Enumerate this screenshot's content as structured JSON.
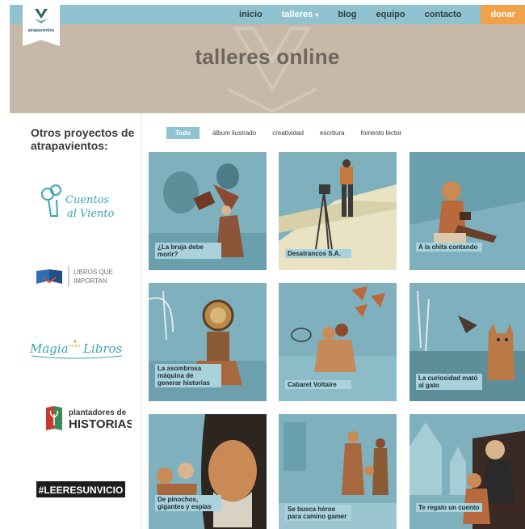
{
  "brand": {
    "name": "atrapavientos"
  },
  "nav": {
    "items": [
      {
        "label": "inicio"
      },
      {
        "label": "talleres"
      },
      {
        "label": "blog"
      },
      {
        "label": "equipo"
      },
      {
        "label": "contacto"
      }
    ],
    "cta": "donar"
  },
  "hero": {
    "title": "talleres online"
  },
  "sidebar": {
    "title": "Otros proyectos de atrapavientos:",
    "projects": [
      {
        "name": "Cuentos al Viento",
        "line1": "Cuentos",
        "line2": "al Viento"
      },
      {
        "name": "Libros que importan",
        "line1": "LIBROS QUE",
        "line2": "IMPORTAN"
      },
      {
        "name": "Magia en los Libros",
        "line1": "Magia",
        "mid": "en los",
        "line2": "Libros"
      },
      {
        "name": "plantadores de HISTORIAS",
        "line1": "plantadores de",
        "line2": "HISTORIAS"
      },
      {
        "name": "#LEERESUNVICIO",
        "line1": "#LEERESUNVICIO"
      }
    ]
  },
  "filters": [
    "Todo",
    "álbum ilustrado",
    "creatividad",
    "escritura",
    "fomento lector"
  ],
  "workshops": [
    {
      "title": "¿La bruja debe morir?"
    },
    {
      "title": "Desatrancos S.A."
    },
    {
      "title": "A la chita contando"
    },
    {
      "title": "La asombrosa máquina de generar historias"
    },
    {
      "title": "Cabaret Voltaire"
    },
    {
      "title": "La curiosidad mató al gato"
    },
    {
      "title": "De pinochos, gigantes y espías"
    },
    {
      "title": "Se busca héroe para camino gamer"
    },
    {
      "title": "Te regalo un cuento"
    }
  ],
  "colors": {
    "nav": "#8fc3cf",
    "hero": "#c6b9a8",
    "donate": "#f0a24a",
    "card_bg": "#7fb0bd",
    "label": "#a9d2dc"
  }
}
